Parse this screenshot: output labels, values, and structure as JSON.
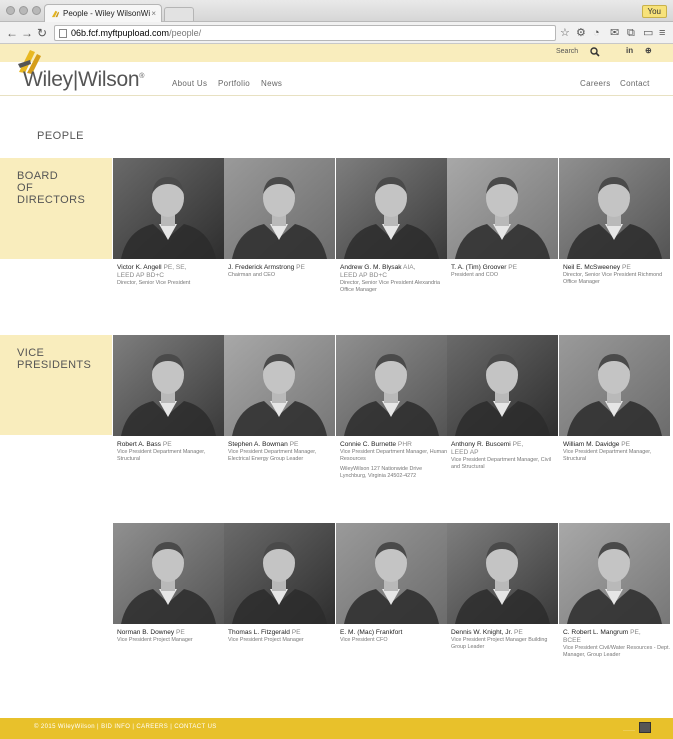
{
  "browser": {
    "tab_title": "People - Wiley WilsonWi",
    "tab_close": "×",
    "user_badge": "You",
    "url_host": "06b.fcf.myftpupload.com",
    "url_path": "/people/"
  },
  "site": {
    "search_label": "Search",
    "social": [
      "in",
      "⊕"
    ],
    "logo": "Wiley|Wilson",
    "logo_reg": "®",
    "nav_left": [
      "About Us",
      "Portfolio",
      "News"
    ],
    "nav_right": [
      "Careers",
      "Contact"
    ],
    "page_title": "PEOPLE",
    "sections": [
      {
        "label_lines": [
          "BOARD",
          "OF",
          "DIRECTORS"
        ],
        "people": [
          {
            "name": "Victor K. Angell",
            "cred": " PE, SE,",
            "cred2": "LEED AP BD+C",
            "title": "Director, Senior Vice President",
            "extra": ""
          },
          {
            "name": "J. Frederick Armstrong",
            "cred": " PE",
            "cred2": "",
            "title": "Chairman and CEO",
            "extra": ""
          },
          {
            "name": "Andrew G. M. Blysak",
            "cred": " AIA,",
            "cred2": "LEED AP BD+C",
            "title": "Director, Senior Vice President Alexandria Office Manager",
            "extra": ""
          },
          {
            "name": "T. A. (Tim) Groover",
            "cred": " PE",
            "cred2": "",
            "title": "President and COO",
            "extra": ""
          },
          {
            "name": "Neil E. McSweeney",
            "cred": " PE",
            "cred2": "",
            "title": "Director, Senior Vice President Richmond Office Manager",
            "extra": ""
          }
        ]
      },
      {
        "label_lines": [
          "VICE",
          "PRESIDENTS"
        ],
        "people": [
          {
            "name": "Robert A. Bass",
            "cred": " PE",
            "cred2": "",
            "title": "Vice President Department Manager, Structural",
            "extra": ""
          },
          {
            "name": "Stephen A. Bowman",
            "cred": " PE",
            "cred2": "",
            "title": "Vice President Department Manager, Electrical Energy Group Leader",
            "extra": ""
          },
          {
            "name": "Connie C. Burnette",
            "cred": " PHR",
            "cred2": "",
            "title": "Vice President Department Manager, Human Resources",
            "extra": "WileyWilson 127 Nationwide Drive Lynchburg, Virginia 24502-4272"
          },
          {
            "name": "Anthony R. Buscemi",
            "cred": " PE,",
            "cred2": "LEED AP",
            "title": "Vice President Department Manager, Civil and Structural",
            "extra": ""
          },
          {
            "name": "William M. Davidge",
            "cred": " PE",
            "cred2": "",
            "title": "Vice President Department Manager, Structural",
            "extra": ""
          }
        ]
      },
      {
        "label_lines": [],
        "people": [
          {
            "name": "Norman B. Downey",
            "cred": " PE",
            "cred2": "",
            "title": "Vice President Project Manager",
            "extra": ""
          },
          {
            "name": "Thomas L. Fitzgerald",
            "cred": " PE",
            "cred2": "",
            "title": "Vice President Project Manager",
            "extra": ""
          },
          {
            "name": "E. M. (Mac) Frankfort",
            "cred": "",
            "cred2": "",
            "title": "Vice President CFO",
            "extra": ""
          },
          {
            "name": "Dennis W. Knight, Jr.",
            "cred": " PE",
            "cred2": "",
            "title": "Vice President Project Manager Building Group Leader",
            "extra": ""
          },
          {
            "name": "C. Robert L. Mangrum",
            "cred": " PE,",
            "cred2": "BCEE",
            "title": "Vice President Civil/Water Resources - Dept. Manager, Group Leader",
            "extra": ""
          }
        ]
      }
    ],
    "footer": "© 2015 WileyWilson   |   BID INFO   |   CAREERS   |   CONTACT US"
  }
}
